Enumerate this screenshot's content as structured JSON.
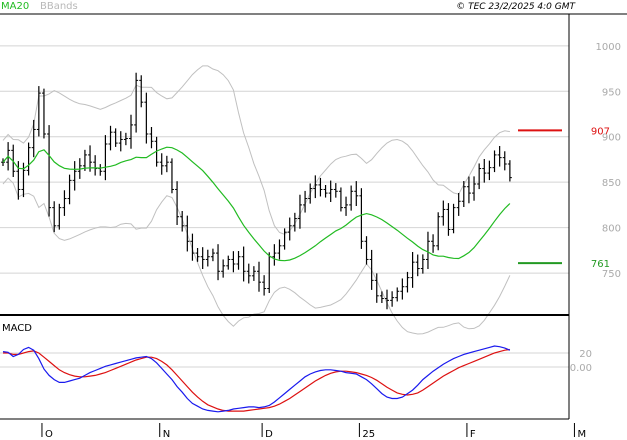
{
  "header": {
    "legend": [
      "MA20",
      "BBands"
    ],
    "copyright": "© TEC 23/2/2025 4:0 GMT"
  },
  "colors": {
    "price": "#000000",
    "ma20": "#22bb22",
    "bbands": "#c0c0c0",
    "macd": "#1a1aee",
    "signal": "#dd1111",
    "resistance": "#dd1111",
    "support": "#229922",
    "grid": "#d4d4d4",
    "frame": "#000000"
  },
  "chart_data": {
    "type": "line",
    "price_panel": {
      "ylim": [
        705,
        1035
      ],
      "y_ticks": [
        750,
        800,
        850,
        900,
        950,
        1000
      ],
      "y_tick_labels": [
        "750",
        "800",
        "850",
        "900",
        "950",
        "1000"
      ],
      "levels": [
        {
          "name": "resistance",
          "value": 907,
          "label": "907"
        },
        {
          "name": "support",
          "value": 761,
          "label": "761"
        }
      ],
      "x_ticks": [
        {
          "i": 8,
          "label": "O"
        },
        {
          "i": 31,
          "label": "N"
        },
        {
          "i": 51,
          "label": "D"
        },
        {
          "i": 70,
          "label": "25"
        },
        {
          "i": 91,
          "label": "F"
        },
        {
          "i": 112,
          "label": "M"
        }
      ],
      "closes": [
        872,
        885,
        862,
        842,
        863,
        888,
        908,
        948,
        903,
        822,
        802,
        822,
        832,
        852,
        862,
        868,
        880,
        872,
        865,
        862,
        892,
        905,
        893,
        897,
        898,
        913,
        962,
        938,
        903,
        895,
        872,
        868,
        872,
        842,
        812,
        802,
        785,
        772,
        768,
        765,
        768,
        772,
        752,
        758,
        765,
        760,
        768,
        752,
        747,
        752,
        740,
        733,
        768,
        772,
        780,
        795,
        802,
        810,
        825,
        832,
        843,
        847,
        842,
        838,
        842,
        840,
        822,
        825,
        840,
        835,
        785,
        765,
        742,
        725,
        722,
        720,
        723,
        730,
        735,
        745,
        762,
        755,
        765,
        785,
        780,
        812,
        820,
        798,
        822,
        829,
        845,
        838,
        848,
        865,
        860,
        866,
        880,
        877,
        870,
        855
      ]
    },
    "macd_panel": {
      "label": "MACD",
      "y_ticks": [
        0,
        20
      ],
      "y_tick_labels": [
        "0.00",
        "20"
      ],
      "macd": [
        22,
        21,
        15,
        18,
        25,
        28,
        24,
        12,
        -3,
        -12,
        -18,
        -22,
        -22,
        -20,
        -18,
        -16,
        -12,
        -8,
        -5,
        -2,
        1,
        3,
        5,
        7,
        9,
        11,
        13,
        14,
        15,
        12,
        6,
        -2,
        -10,
        -18,
        -28,
        -36,
        -45,
        -52,
        -56,
        -60,
        -62,
        -63,
        -64,
        -63,
        -62,
        -60,
        -59,
        -58,
        -57,
        -57,
        -58,
        -57,
        -55,
        -50,
        -44,
        -38,
        -32,
        -26,
        -20,
        -14,
        -10,
        -7,
        -5,
        -4,
        -4,
        -5,
        -6,
        -8,
        -9,
        -10,
        -14,
        -18,
        -24,
        -31,
        -38,
        -43,
        -45,
        -45,
        -43,
        -38,
        -33,
        -26,
        -18,
        -12,
        -6,
        -1,
        4,
        8,
        12,
        15,
        18,
        20,
        22,
        24,
        26,
        28,
        30,
        29,
        27,
        24
      ],
      "signal": [
        20,
        20,
        18,
        18,
        20,
        22,
        23,
        20,
        14,
        8,
        2,
        -4,
        -8,
        -11,
        -13,
        -14,
        -14,
        -13,
        -12,
        -10,
        -8,
        -5,
        -2,
        1,
        4,
        7,
        10,
        12,
        14,
        14,
        12,
        8,
        3,
        -4,
        -12,
        -20,
        -28,
        -36,
        -43,
        -49,
        -54,
        -57,
        -60,
        -62,
        -63,
        -63,
        -63,
        -63,
        -62,
        -61,
        -60,
        -59,
        -58,
        -56,
        -53,
        -49,
        -45,
        -40,
        -35,
        -30,
        -25,
        -20,
        -16,
        -12,
        -9,
        -7,
        -6,
        -6,
        -7,
        -8,
        -10,
        -12,
        -15,
        -19,
        -24,
        -29,
        -33,
        -37,
        -39,
        -40,
        -39,
        -37,
        -33,
        -28,
        -23,
        -18,
        -13,
        -9,
        -5,
        -1,
        2,
        5,
        8,
        11,
        14,
        17,
        20,
        22,
        24,
        25
      ]
    }
  }
}
